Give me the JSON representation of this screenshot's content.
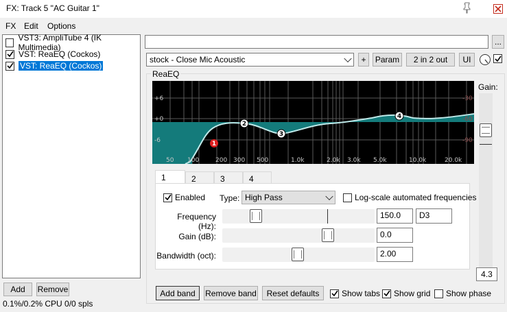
{
  "window": {
    "title": "FX: Track 5 \"AC Guitar 1\""
  },
  "menu": [
    "FX",
    "Edit",
    "Options"
  ],
  "fx_list": [
    {
      "label": "VST3: AmpliTube 4 (IK Multimedia)",
      "checked": false,
      "selected": false
    },
    {
      "label": "VST: ReaEQ (Cockos)",
      "checked": true,
      "selected": false
    },
    {
      "label": "VST: ReaEQ (Cockos)",
      "checked": true,
      "selected": true
    }
  ],
  "left_buttons": {
    "add": "Add",
    "remove": "Remove"
  },
  "cpu": "0.1%/0.2% CPU 0/0 spls",
  "top_field": {
    "value": "",
    "browse": "..."
  },
  "preset": {
    "value": "stock - Close Mic Acoustic",
    "plus": "+",
    "param": "Param",
    "io": "2 in 2 out",
    "ui": "UI"
  },
  "plugin_label": "ReaEQ",
  "graph": {
    "db_labels": [
      "+6",
      "+0",
      "-6"
    ],
    "db_right": [
      "-30",
      "-60",
      "-90"
    ],
    "freq_labels": [
      "50",
      "100",
      "200",
      "300",
      "500",
      "1.0k",
      "2.0k",
      "3.0k",
      "5.0k",
      "10.0k",
      "20.0k"
    ],
    "bands": [
      "1",
      "2",
      "3",
      "4"
    ]
  },
  "gain": {
    "label": "Gain:",
    "value": "4.3"
  },
  "tabs": [
    "1",
    "2",
    "3",
    "4"
  ],
  "band": {
    "enabled_label": "Enabled",
    "type_label": "Type:",
    "type_value": "High Pass",
    "log_label": "Log-scale automated frequencies",
    "frequency_label": "Frequency (Hz):",
    "frequency_value": "150.0",
    "note_value": "D3",
    "gain_label": "Gain (dB):",
    "gain_value": "0.0",
    "bandwidth_label": "Bandwidth (oct):",
    "bandwidth_value": "2.00"
  },
  "bottom": {
    "add_band": "Add band",
    "remove_band": "Remove band",
    "reset_defaults": "Reset defaults",
    "show_tabs": "Show tabs",
    "show_grid": "Show grid",
    "show_phase": "Show phase"
  },
  "colors": {
    "selection": "#0078d7",
    "eq_fill": "#147b7b",
    "eq_curve": "#bfe9e9",
    "band1": "#e02020"
  }
}
